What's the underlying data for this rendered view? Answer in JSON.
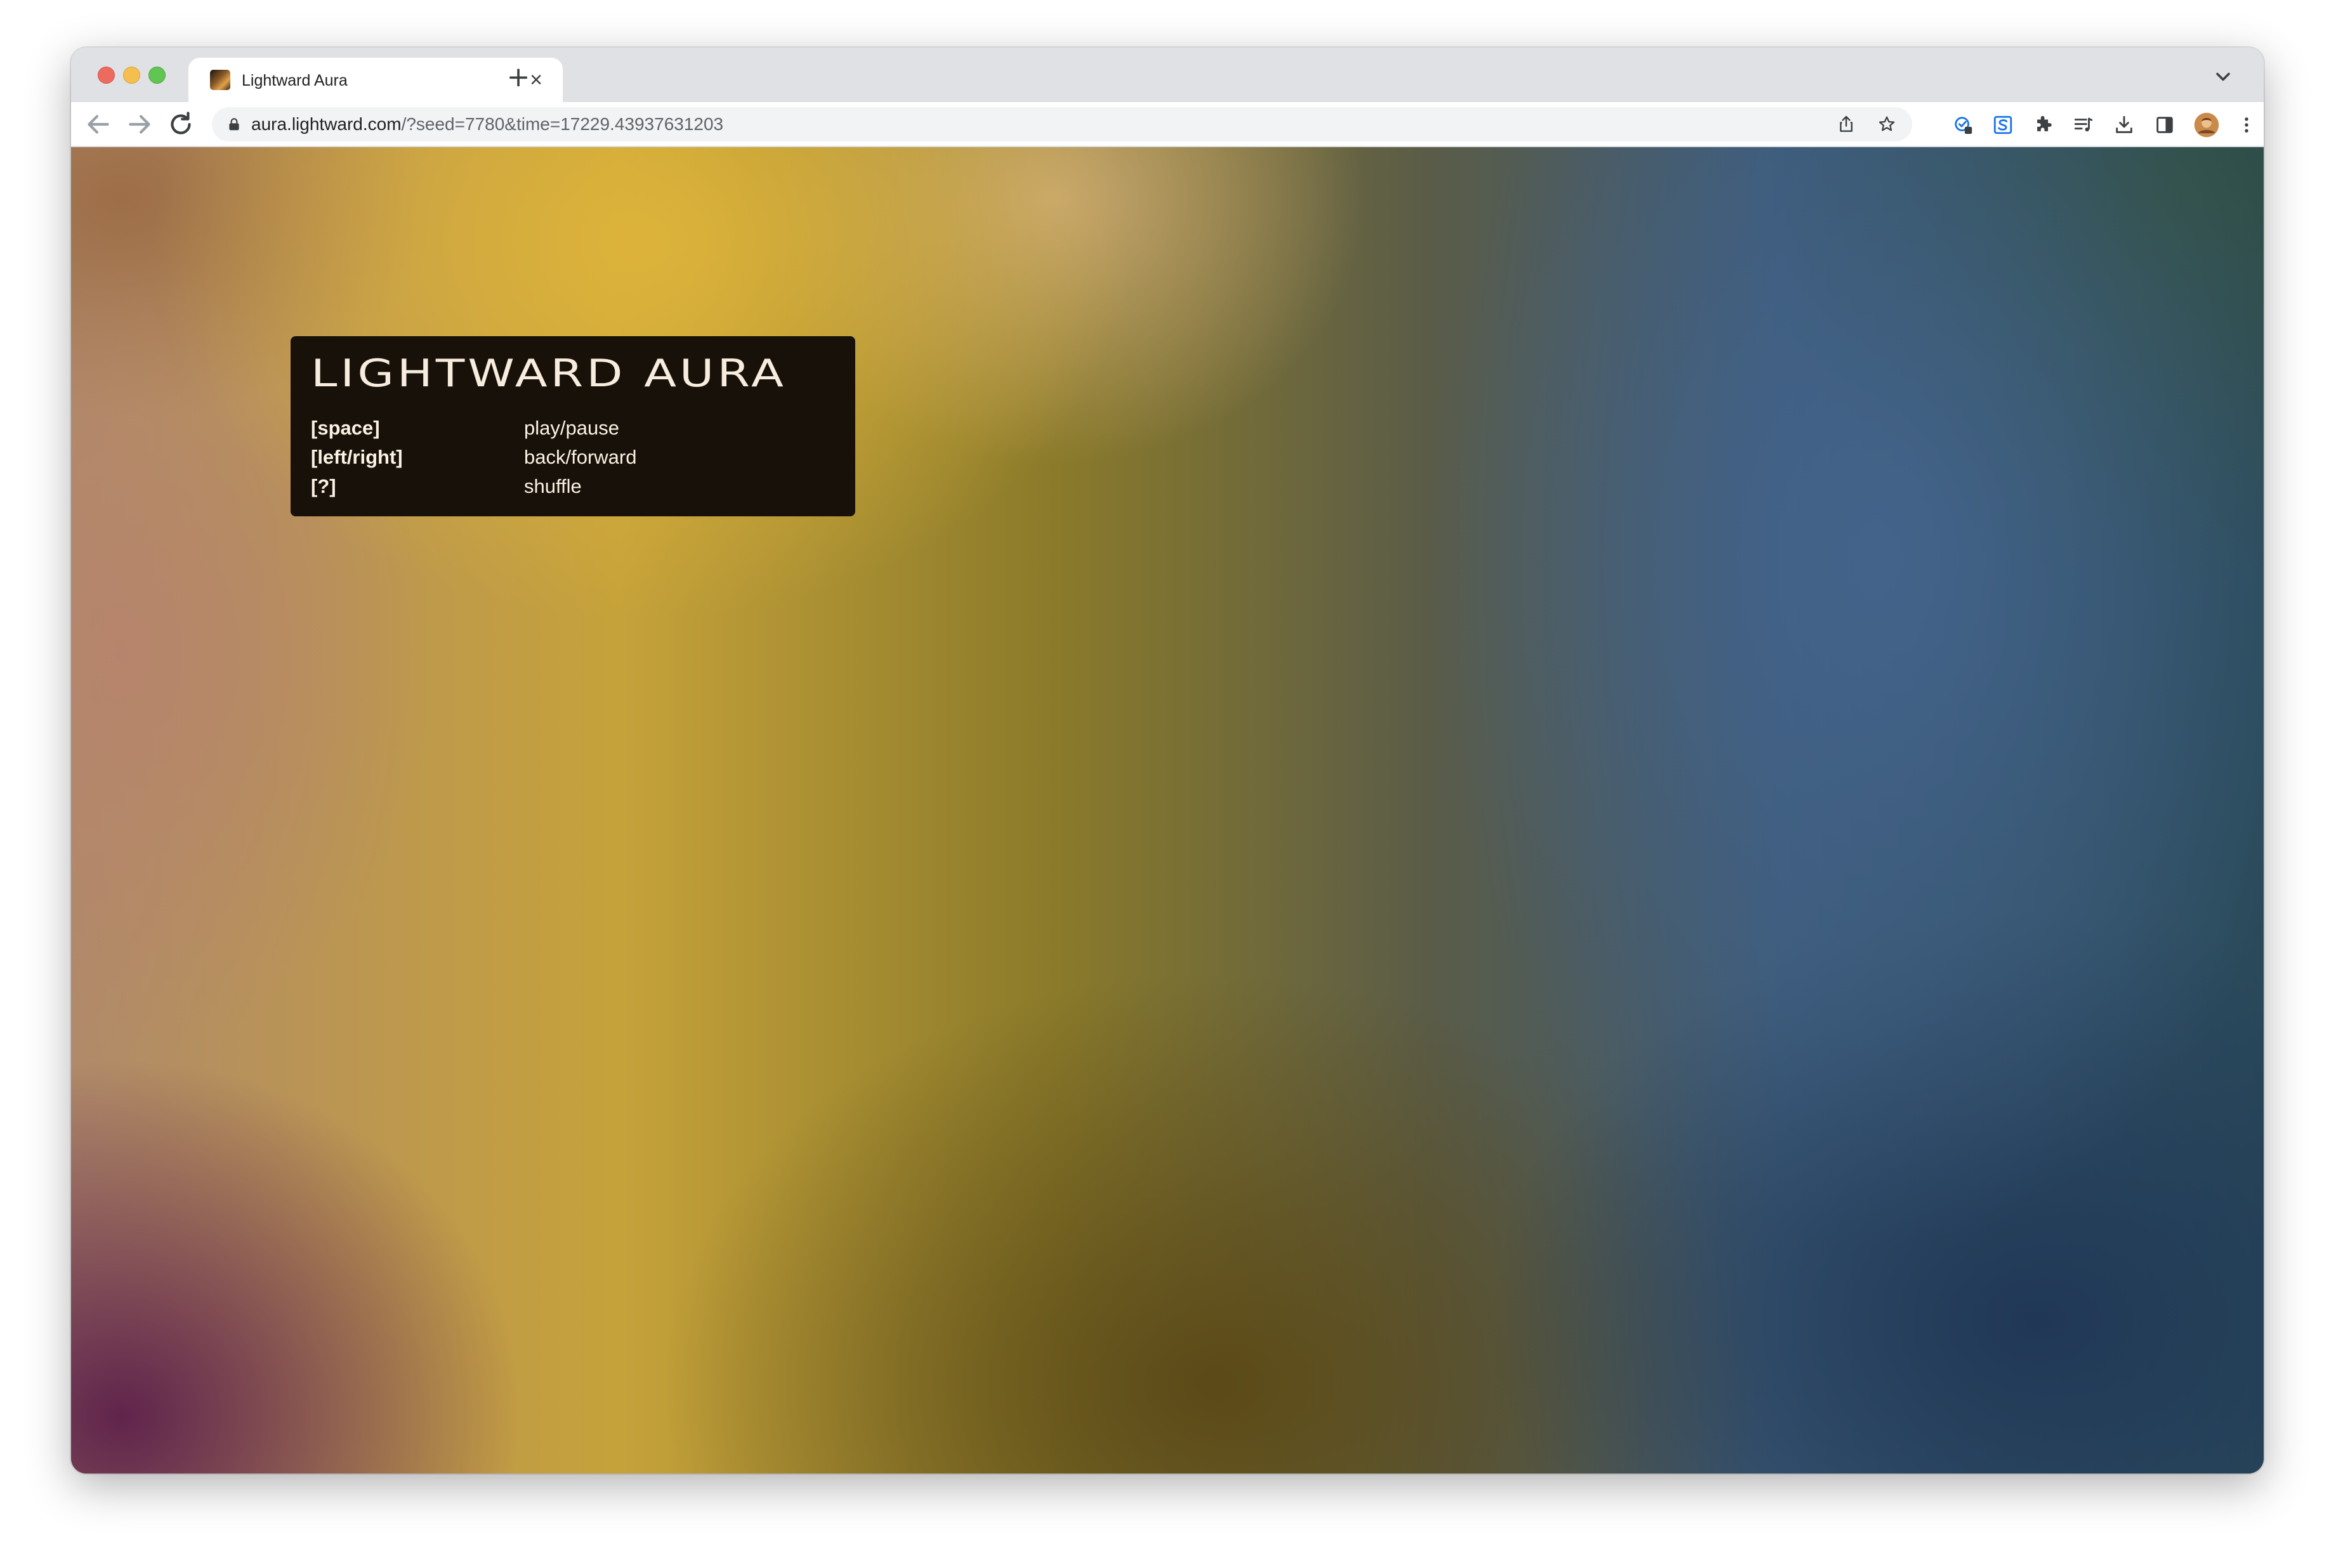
{
  "browser": {
    "tab": {
      "title": "Lightward Aura",
      "favicon": "lightward-favicon-icon",
      "close_glyph": "×"
    },
    "new_tab_glyph": "+",
    "address_bar": {
      "host": "aura.lightward.com",
      "path": "/?seed=7780&time=17229.43937631203"
    },
    "toolbar_icons": [
      "back-icon",
      "forward-icon",
      "reload-icon",
      "lock-icon",
      "share-icon",
      "bookmark-star-icon",
      "extension-icon-1",
      "extension-icon-2",
      "puzzle-extensions-icon",
      "reading-list-icon",
      "download-icon",
      "side-panel-icon",
      "profile-avatar",
      "more-menu-icon"
    ]
  },
  "page": {
    "title": "LIGHTWARD AURA",
    "shortcuts": [
      {
        "key": "[space]",
        "action": "play/pause"
      },
      {
        "key": "[left/right]",
        "action": "back/forward"
      },
      {
        "key": "[?]",
        "action": "shuffle"
      }
    ]
  },
  "colors": {
    "panel_background": "#171109",
    "panel_text": "#f7ecdd",
    "gradient_gold": "#deb43a",
    "gradient_blue": "#44648c",
    "gradient_purple": "#60244c",
    "gradient_navy": "#203856"
  }
}
